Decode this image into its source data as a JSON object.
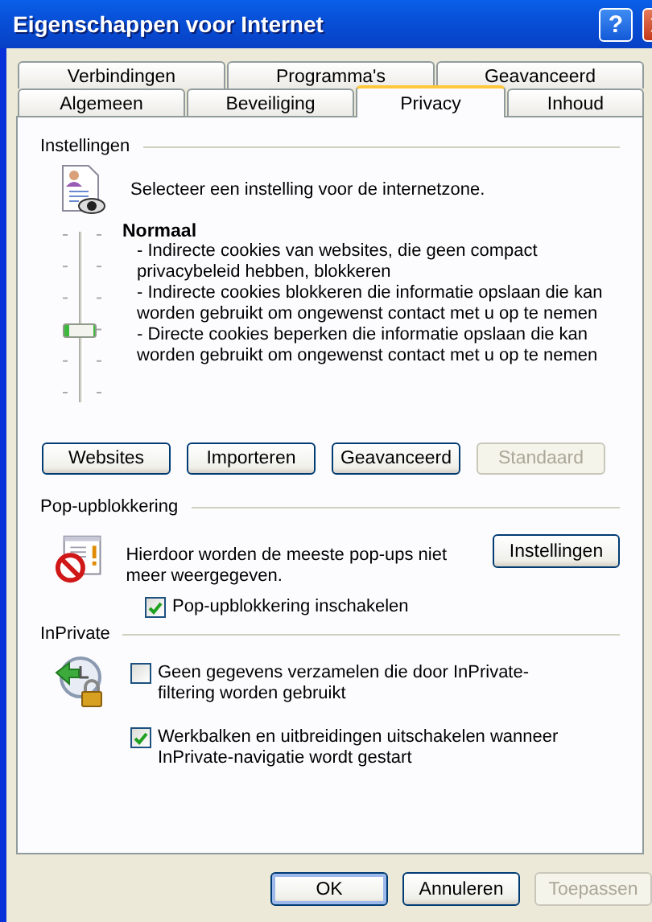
{
  "window": {
    "title": "Eigenschappen voor Internet",
    "help_button": "?"
  },
  "tab_rows": [
    [
      {
        "label": "Verbindingen",
        "selected": false
      },
      {
        "label": "Programma's",
        "selected": false
      },
      {
        "label": "Geavanceerd",
        "selected": false
      }
    ],
    [
      {
        "label": "Algemeen",
        "selected": false
      },
      {
        "label": "Beveiliging",
        "selected": false
      },
      {
        "label": "Privacy",
        "selected": true
      },
      {
        "label": "Inhoud",
        "selected": false
      }
    ]
  ],
  "settings": {
    "heading": "Instellingen",
    "intro": "Selecteer een instelling voor de internetzone.",
    "slider": {
      "level": 0.4
    },
    "level_title": "Normaal",
    "description": [
      "- Indirecte cookies van websites, die geen compact privacybeleid hebben, blokkeren",
      "- Indirecte cookies blokkeren die informatie opslaan die kan worden gebruikt om ongewenst contact met u op te nemen",
      "- Directe cookies beperken die informatie opslaan die kan worden gebruikt om ongewenst contact met u op te nemen"
    ],
    "buttons": [
      {
        "label": "Websites",
        "disabled": false
      },
      {
        "label": "Importeren",
        "disabled": false
      },
      {
        "label": "Geavanceerd",
        "disabled": false
      },
      {
        "label": "Standaard",
        "disabled": true
      }
    ]
  },
  "popup_blocking": {
    "heading": "Pop-upblokkering",
    "text": "Hierdoor worden de meeste pop-ups niet meer weergegeven.",
    "button": "Instellingen",
    "checkbox": {
      "label": "Pop-upblokkering inschakelen",
      "checked": true
    }
  },
  "inprivate": {
    "heading": "InPrivate",
    "checkboxes": [
      {
        "label": "Geen gegevens verzamelen die door InPrivate-filtering worden gebruikt",
        "checked": false
      },
      {
        "label": "Werkbalken en uitbreidingen uitschakelen wanneer InPrivate-navigatie wordt gestart",
        "checked": true
      }
    ]
  },
  "footer_buttons": [
    {
      "label": "OK",
      "default": true,
      "disabled": false
    },
    {
      "label": "Annuleren",
      "default": false,
      "disabled": false
    },
    {
      "label": "Toepassen",
      "default": false,
      "disabled": true
    }
  ]
}
